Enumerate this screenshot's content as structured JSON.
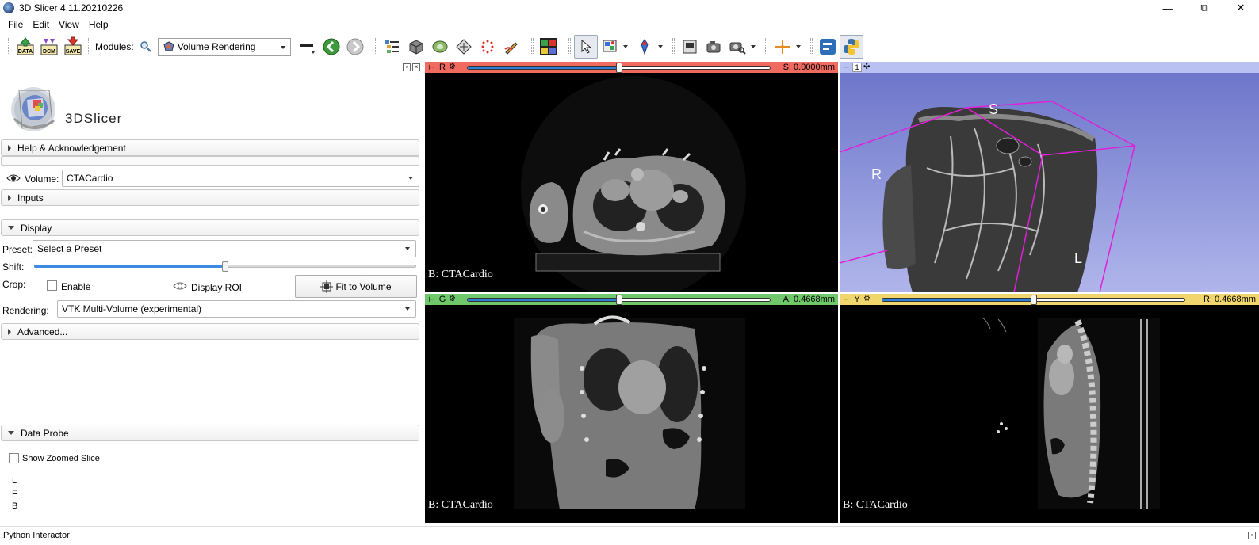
{
  "window": {
    "title": "3D Slicer 4.11.20210226",
    "controls": [
      "—",
      "⧉",
      "✕"
    ]
  },
  "menu": [
    "File",
    "Edit",
    "View",
    "Help"
  ],
  "toolbar": {
    "modules_label": "Modules:",
    "module_selected": "Volume Rendering",
    "data_label": "DATA",
    "dcm_label": "DCM",
    "save_label": "SAVE"
  },
  "left_panel": {
    "logo_text": "3DSlicer",
    "help_section": "Help & Acknowledgement",
    "volume_label": "Volume:",
    "volume_value": "CTACardio",
    "inputs_section": "Inputs",
    "display_section": "Display",
    "preset_label": "Preset:",
    "preset_value": "Select a Preset",
    "shift_label": "Shift:",
    "shift_position": 0.5,
    "crop_label": "Crop:",
    "enable_label": "Enable",
    "display_roi_label": "Display ROI",
    "fit_to_volume_label": "Fit to Volume",
    "rendering_label": "Rendering:",
    "rendering_value": "VTK Multi-Volume (experimental)",
    "advanced_section": "Advanced...",
    "data_probe_section": "Data Probe",
    "show_zoomed_slice_label": "Show Zoomed Slice",
    "probe_lines": [
      "L",
      "F",
      "B"
    ]
  },
  "python_interactor_label": "Python Interactor",
  "views": {
    "red": {
      "label": "R",
      "readout": "S: 0.0000mm",
      "caption": "B: CTACardio",
      "color": "#f06a5f",
      "slider_position": 0.5
    },
    "threed": {
      "label": "1",
      "color": "#b8c1f2",
      "orient_s": "S",
      "orient_r": "R",
      "orient_l": "L"
    },
    "green": {
      "label": "G",
      "readout": "A: 0.4668mm",
      "caption": "B: CTACardio",
      "color": "#6fc96a",
      "slider_position": 0.5
    },
    "yellow": {
      "label": "Y",
      "readout": "R: 0.4668mm",
      "caption": "B: CTACardio",
      "color": "#f0d66c",
      "slider_position": 0.5
    }
  }
}
